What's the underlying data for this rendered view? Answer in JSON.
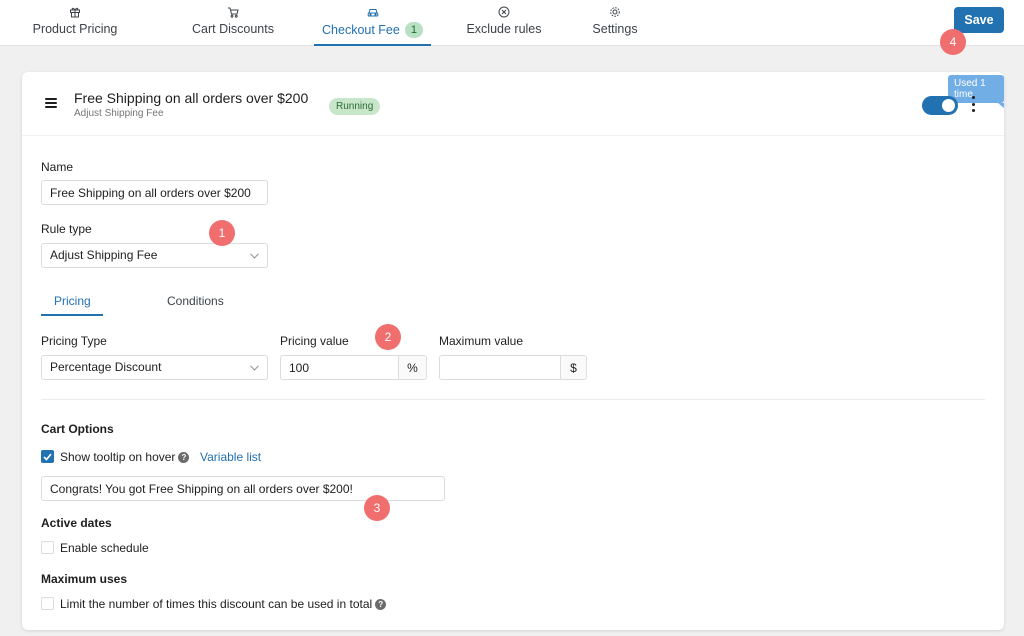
{
  "tabs": [
    {
      "label": "Product Pricing",
      "icon": "gift-icon"
    },
    {
      "label": "Cart Discounts",
      "icon": "cart-icon"
    },
    {
      "label": "Checkout Fee",
      "icon": "car-icon",
      "badge": "1"
    },
    {
      "label": "Exclude rules",
      "icon": "circle-x-icon"
    },
    {
      "label": "Settings",
      "icon": "gear-icon"
    }
  ],
  "active_tab": "Checkout Fee",
  "save_label": "Save",
  "steps": [
    "1",
    "2",
    "3",
    "4"
  ],
  "rule": {
    "title": "Free Shipping on all orders over $200",
    "subtitle": "Adjust Shipping Fee",
    "status": "Running",
    "used_tooltip": "Used 1 time",
    "enabled": true
  },
  "form": {
    "name_label": "Name",
    "name_value": "Free Shipping on all orders over $200",
    "rule_type_label": "Rule type",
    "rule_type_value": "Adjust Shipping Fee",
    "subtabs": [
      "Pricing",
      "Conditions"
    ],
    "pricing_type_label": "Pricing Type",
    "pricing_type_value": "Percentage Discount",
    "pricing_value_label": "Pricing value",
    "pricing_value": "100",
    "pricing_unit": "%",
    "max_value_label": "Maximum value",
    "max_value": "",
    "max_unit": "$",
    "cart_options_label": "Cart Options",
    "tooltip_checkbox_label": "Show tooltip on hover",
    "tooltip_checked": true,
    "variable_list_link": "Variable list",
    "tooltip_text": "Congrats! You got Free Shipping on all orders over $200!",
    "active_dates_label": "Active dates",
    "enable_schedule_label": "Enable schedule",
    "max_uses_label": "Maximum uses",
    "limit_label": "Limit the number of times this discount can be used in total"
  },
  "colors": {
    "accent": "#2271b1",
    "step_marker": "#f06e6e",
    "running_bg": "#c8e6c9"
  }
}
